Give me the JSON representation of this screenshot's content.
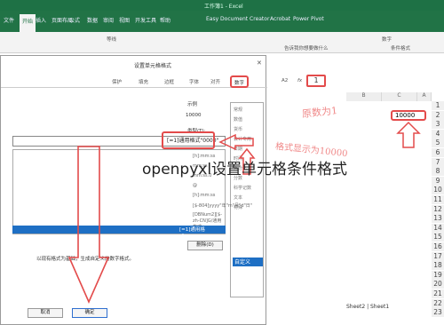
{
  "titlebar": {
    "title": "工作簿1 - Excel"
  },
  "ribbon_tabs": [
    "文件",
    "开始",
    "插入",
    "页面布局",
    "公式",
    "数据",
    "审阅",
    "视图",
    "开发工具",
    "帮助",
    "Easy Document Creator",
    "Acrobat",
    "Power Pivot"
  ],
  "ribbon_active": "开始",
  "ribbon_labels": {
    "font_name": "等线",
    "search": "告诉我你想要做什么",
    "cond_format": "条件格式",
    "number": "数字"
  },
  "formula_bar": {
    "name_box": "A2",
    "fx": "fx",
    "cell_content": "1"
  },
  "grid": {
    "columns": [
      "B",
      "C",
      "A"
    ],
    "rows": [
      "1",
      "2",
      "3",
      "4",
      "5",
      "6",
      "7",
      "8",
      "9",
      "10",
      "11",
      "12",
      "13",
      "14",
      "15",
      "16",
      "17",
      "18",
      "19",
      "20",
      "21",
      "22",
      "23"
    ],
    "cell_value": "10000",
    "annotation_left": "原数为1",
    "annotation_right": "格式显示为10000",
    "sheet_tab": "Sheet2 | Sheet1"
  },
  "dialog": {
    "title": "设置单元格格式",
    "tabs": [
      "数字",
      "对齐",
      "字体",
      "边框",
      "填充",
      "保护"
    ],
    "active_tab": "数字",
    "sample_label": "示例",
    "sample_value": "10000",
    "type_label": "类型(T):",
    "type_value": "[=1]通用格式\"0000\"",
    "categories": [
      "常规",
      "数值",
      "货币",
      "会计专用",
      "日期",
      "时间",
      "百分比",
      "分数",
      "科学记数",
      "文本",
      "特殊"
    ],
    "selected_category": "自定义",
    "list_items": [
      "[h]:mm:ss",
      "mm:ss",
      "mm:ss.0",
      "@",
      "[h]:mm:ss",
      "[$-804]yyyy\"年\"m\"月\"d\"日\"",
      "[DBNum2][$-zh-CN]G/通用格式"
    ],
    "selected_list_item": "[=1]通用格式\"0000\"",
    "hint": "以现有格式为基础，生成自定义的数字格式。",
    "delete_label": "删除(D)",
    "ok_label": "确定",
    "cancel_label": "取消"
  },
  "overlay_title": "openpyxl设置单元格条件格式",
  "colors": {
    "excel_green": "#217346",
    "annotation_red": "#e34b4b",
    "selection_blue": "#1e6fc4"
  }
}
